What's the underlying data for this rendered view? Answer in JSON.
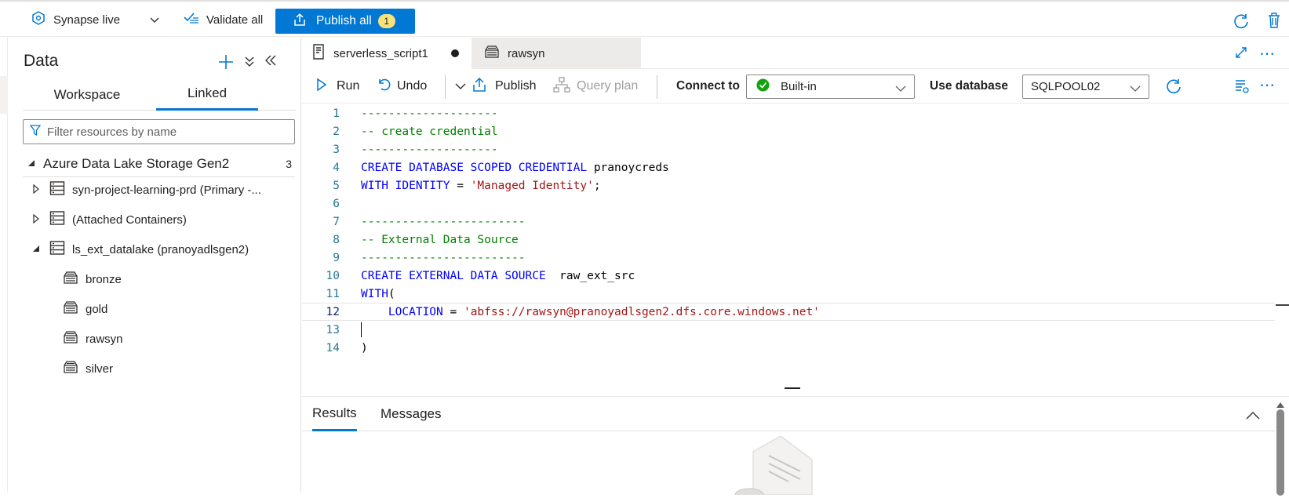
{
  "topbar": {
    "workspace_mode": "Synapse live",
    "validate_label": "Validate all",
    "publish_label": "Publish all",
    "publish_count": "1"
  },
  "data_panel": {
    "title": "Data",
    "tabs": [
      {
        "label": "Workspace",
        "active": false
      },
      {
        "label": "Linked",
        "active": true
      }
    ],
    "filter_placeholder": "Filter resources by name",
    "section": {
      "label": "Azure Data Lake Storage Gen2",
      "count": "3"
    },
    "items": [
      {
        "label": "syn-project-learning-prd (Primary -...",
        "expanded": false
      },
      {
        "label": "(Attached Containers)",
        "expanded": false
      },
      {
        "label": "ls_ext_datalake (pranoyadlsgen2)",
        "expanded": true
      }
    ],
    "containers": [
      "bronze",
      "gold",
      "rawsyn",
      "silver"
    ]
  },
  "editor": {
    "tabs": [
      {
        "label": "serverless_script1",
        "active": true,
        "unsaved": true
      },
      {
        "label": "rawsyn",
        "active": false
      }
    ],
    "toolbar": {
      "run": "Run",
      "undo": "Undo",
      "publish": "Publish",
      "query_plan": "Query plan",
      "connect_to_label": "Connect to",
      "connect_to_value": "Built-in",
      "use_database_label": "Use database",
      "use_database_value": "SQLPOOL02"
    },
    "code_lines": [
      "--------------------",
      "-- create credential",
      "--------------------",
      "CREATE DATABASE SCOPED CREDENTIAL pranoycreds",
      "WITH IDENTITY = 'Managed Identity';",
      "",
      "------------------------",
      "-- External Data Source",
      "------------------------",
      "CREATE EXTERNAL DATA SOURCE  raw_ext_src",
      "WITH(",
      "    LOCATION = 'abfss://rawsyn@pranoyadlsgen2.dfs.core.windows.net'",
      "",
      ")"
    ],
    "current_line": 12
  },
  "results": {
    "tabs": [
      {
        "label": "Results",
        "active": true
      },
      {
        "label": "Messages",
        "active": false
      }
    ]
  },
  "colors": {
    "accent": "#0078d4",
    "keyword": "#0000ff",
    "comment": "#008000",
    "string": "#a31515",
    "line_number": "#237893",
    "success": "#13a10e"
  }
}
